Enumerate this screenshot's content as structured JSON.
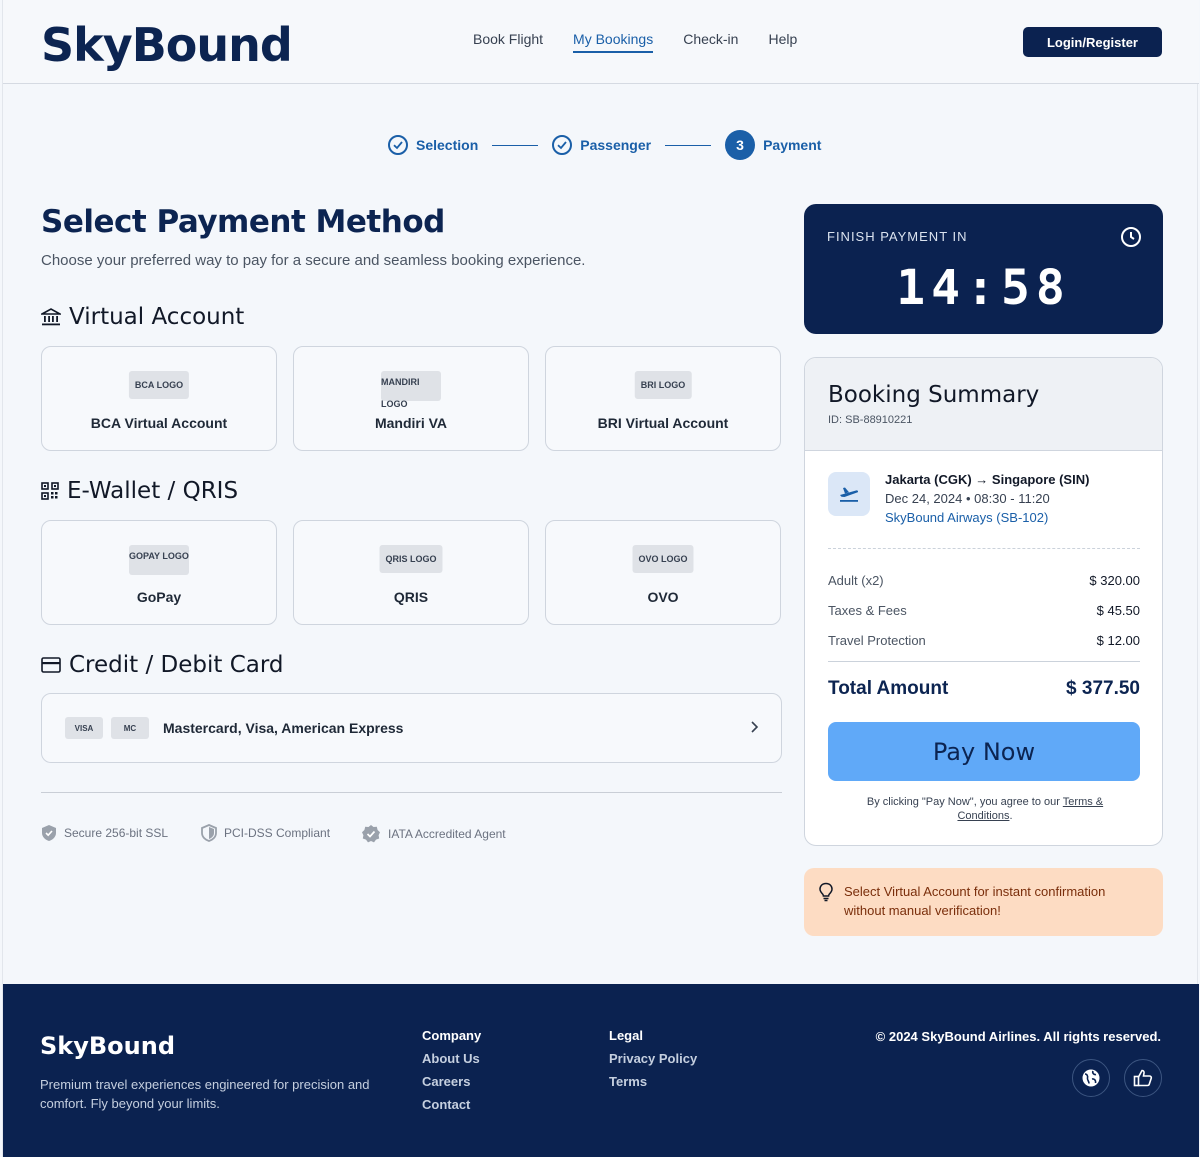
{
  "header": {
    "logo": "SkyBound",
    "nav": [
      "Book Flight",
      "My Bookings",
      "Check-in",
      "Help"
    ],
    "login": "Login/Register"
  },
  "stepper": {
    "steps": [
      {
        "label": "Selection",
        "status": "done"
      },
      {
        "label": "Passenger",
        "status": "done"
      },
      {
        "label": "Payment",
        "status": "current",
        "number": "3"
      }
    ]
  },
  "main": {
    "title": "Select Payment Method",
    "subtitle": "Choose your preferred way to pay for a secure and seamless booking experience.",
    "virtual_account": {
      "heading": "Virtual Account",
      "options": [
        {
          "logo": "BCA LOGO",
          "label": "BCA Virtual Account"
        },
        {
          "logo": "MANDIRI LOGO",
          "label": "Mandiri VA"
        },
        {
          "logo": "BRI LOGO",
          "label": "BRI Virtual Account"
        }
      ]
    },
    "ewallet": {
      "heading": "E-Wallet / QRIS",
      "options": [
        {
          "logo": "GOPAY LOGO",
          "label": "GoPay"
        },
        {
          "logo": "QRIS LOGO",
          "label": "QRIS"
        },
        {
          "logo": "OVO LOGO",
          "label": "OVO"
        }
      ]
    },
    "card": {
      "heading": "Credit / Debit Card",
      "badges": [
        "VISA",
        "MC"
      ],
      "text": "Mastercard, Visa, American Express"
    },
    "trust": [
      "Secure 256-bit SSL",
      "PCI-DSS Compliant",
      "IATA Accredited Agent"
    ]
  },
  "timer": {
    "label": "FINISH PAYMENT IN",
    "value": "14:58"
  },
  "summary": {
    "title": "Booking Summary",
    "id": "ID: SB-88910221",
    "route": "Jakarta (CGK) → Singapore (SIN)",
    "time": "Dec 24, 2024 • 08:30 - 11:20",
    "airline": "SkyBound Airways (SB-102)",
    "rows": [
      {
        "label": "Adult (x2)",
        "amount": "$ 320.00"
      },
      {
        "label": "Taxes & Fees",
        "amount": "$ 45.50"
      },
      {
        "label": "Travel Protection",
        "amount": "$ 12.00"
      }
    ],
    "total_label": "Total Amount",
    "total_amount": "$ 377.50",
    "pay_button": "Pay Now",
    "terms_prefix": "By clicking \"Pay Now\", you agree to our",
    "terms_link": "Terms & Conditions"
  },
  "tip": "Select Virtual Account for instant confirmation without manual verification!",
  "footer": {
    "logo": "SkyBound",
    "description": "Premium travel experiences engineered for precision and comfort. Fly beyond your limits.",
    "company": [
      "Company",
      "About Us",
      "Careers",
      "Contact"
    ],
    "legal": [
      "Legal",
      "Privacy Policy",
      "Terms"
    ],
    "copyright": "© 2024 SkyBound Airlines. All rights reserved."
  },
  "colors": {
    "navy": "#0b2250",
    "accent": "#1a5fa8",
    "pay_button": "#60a9f8",
    "tip_bg": "#fddcc3"
  }
}
